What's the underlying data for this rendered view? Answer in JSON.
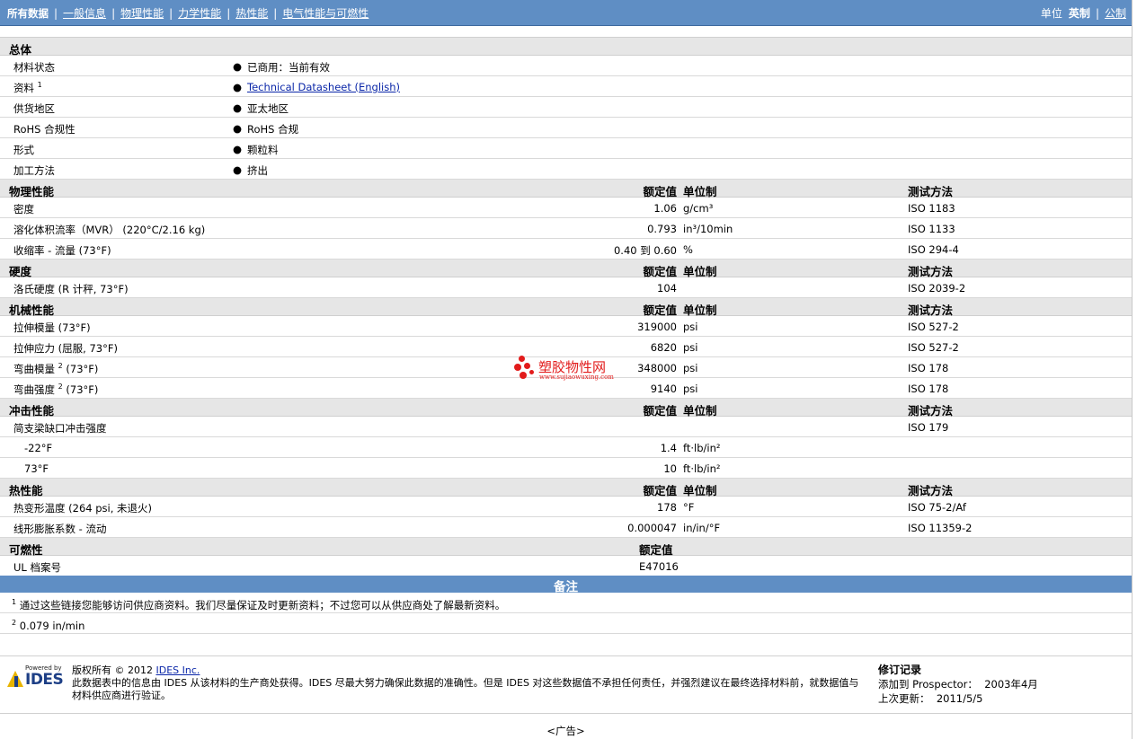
{
  "nav": {
    "tabs": [
      "所有数据",
      "一般信息",
      "物理性能",
      "力学性能",
      "热性能",
      "电气性能与可燃性"
    ],
    "units_label": "单位",
    "unit_selected": "英制",
    "unit_other": "公制"
  },
  "general": {
    "title": "总体",
    "rows": [
      {
        "label": "材料状态",
        "sup": "",
        "value": "已商用：当前有效",
        "link": false
      },
      {
        "label": "资料",
        "sup": "1",
        "value": "Technical Datasheet (English)",
        "link": true
      },
      {
        "label": "供货地区",
        "sup": "",
        "value": "亚太地区",
        "link": false
      },
      {
        "label": "RoHS 合规性",
        "sup": "",
        "value": "RoHS 合规",
        "link": false
      },
      {
        "label": "形式",
        "sup": "",
        "value": "颗粒料",
        "link": false
      },
      {
        "label": "加工方法",
        "sup": "",
        "value": "挤出",
        "link": false
      }
    ]
  },
  "headers": {
    "value": "额定值",
    "unit": "单位制",
    "test": "测试方法"
  },
  "physical": {
    "title": "物理性能",
    "rows": [
      {
        "label": "密度",
        "value": "1.06",
        "unit": "g/cm³",
        "test": "ISO 1183"
      },
      {
        "label": "溶化体积流率（MVR） (220°C/2.16 kg)",
        "value": "0.793",
        "unit": "in³/10min",
        "test": "ISO 1133"
      },
      {
        "label": "收缩率 - 流量 (73°F)",
        "value": "0.40 到 0.60",
        "unit": "%",
        "test": "ISO 294-4"
      }
    ]
  },
  "hardness": {
    "title": "硬度",
    "rows": [
      {
        "label": "洛氏硬度 (R 计秤, 73°F)",
        "value": "104",
        "unit": "",
        "test": "ISO 2039-2"
      }
    ]
  },
  "mechanical": {
    "title": "机械性能",
    "rows": [
      {
        "label": "拉伸模量 (73°F)",
        "sup": "",
        "value": "319000",
        "unit": "psi",
        "test": "ISO 527-2"
      },
      {
        "label": "拉伸应力 (屈服, 73°F)",
        "sup": "",
        "value": "6820",
        "unit": "psi",
        "test": "ISO 527-2"
      },
      {
        "label": "弯曲模量",
        "sup": "2",
        "suffix": " (73°F)",
        "value": "348000",
        "unit": "psi",
        "test": "ISO 178"
      },
      {
        "label": "弯曲强度",
        "sup": "2",
        "suffix": " (73°F)",
        "value": "9140",
        "unit": "psi",
        "test": "ISO 178"
      }
    ]
  },
  "impact": {
    "title": "冲击性能",
    "rows": [
      {
        "label": "简支梁缺口冲击强度",
        "value": "",
        "unit": "",
        "test": "ISO 179"
      },
      {
        "label": "-22°F",
        "value": "1.4",
        "unit": "ft·lb/in²",
        "test": ""
      },
      {
        "label": "73°F",
        "value": "10",
        "unit": "ft·lb/in²",
        "test": ""
      }
    ]
  },
  "thermal": {
    "title": "热性能",
    "rows": [
      {
        "label": "热变形温度 (264 psi, 未退火)",
        "value": "178",
        "unit": "°F",
        "test": "ISO 75-2/Af"
      },
      {
        "label": "线形膨胀系数 - 流动",
        "value": "0.000047",
        "unit": "in/in/°F",
        "test": "ISO 11359-2"
      }
    ]
  },
  "flammability": {
    "title": "可燃性",
    "value_header": "额定值",
    "rows": [
      {
        "label": "UL 档案号",
        "value": "E47016"
      }
    ]
  },
  "notes": {
    "title": "备注",
    "items": [
      {
        "num": "1",
        "text": "通过这些链接您能够访问供应商资料。我们尽量保证及时更新资料；不过您可以从供应商处了解最新资料。"
      },
      {
        "num": "2",
        "text": "0.079 in/min"
      }
    ]
  },
  "watermark": {
    "cn": "塑胶物性网",
    "url": "www.sujiaowuxing.com"
  },
  "footer": {
    "powered_by": "Powered by",
    "logo_text": "IDES",
    "copyright_prefix": "版权所有 © 2012",
    "copyright_link": "IDES Inc.",
    "disclaimer": "此数据表中的信息由 IDES 从该材料的生产商处获得。IDES 尽最大努力确保此数据的准确性。但是 IDES 对这些数据值不承担任何责任，并强烈建议在最终选择材料前，就数据值与材料供应商进行验证。",
    "revision_title": "修订记录",
    "added_label": "添加到 Prospector：",
    "added_date": "2003年4月",
    "updated_label": "上次更新：",
    "updated_date": "2011/5/5",
    "ad": "<广告>"
  }
}
